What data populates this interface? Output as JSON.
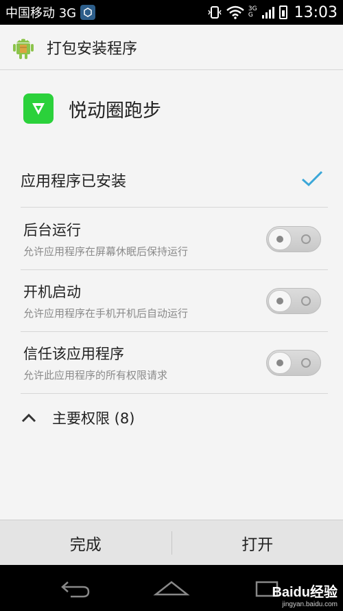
{
  "status_bar": {
    "carrier": "中国移动 3G",
    "network_small_top": "3G",
    "network_small_bottom": "G",
    "time": "13:03"
  },
  "action_bar": {
    "title": "打包安装程序"
  },
  "app": {
    "name": "悦动圈跑步",
    "icon_color": "#2bd13b"
  },
  "installed": {
    "label": "应用程序已安装",
    "check_color": "#3ba7d8"
  },
  "settings": [
    {
      "title": "后台运行",
      "description": "允许应用程序在屏幕休眠后保持运行",
      "enabled": false
    },
    {
      "title": "开机启动",
      "description": "允许应用程序在手机开机后自动运行",
      "enabled": false
    },
    {
      "title": "信任该应用程序",
      "description": "允许此应用程序的所有权限请求",
      "enabled": false
    }
  ],
  "permissions": {
    "label": "主要权限 (8)"
  },
  "buttons": {
    "done": "完成",
    "open": "打开"
  },
  "watermark": {
    "main": "Baidu经验",
    "sub": "jingyan.baidu.com"
  }
}
